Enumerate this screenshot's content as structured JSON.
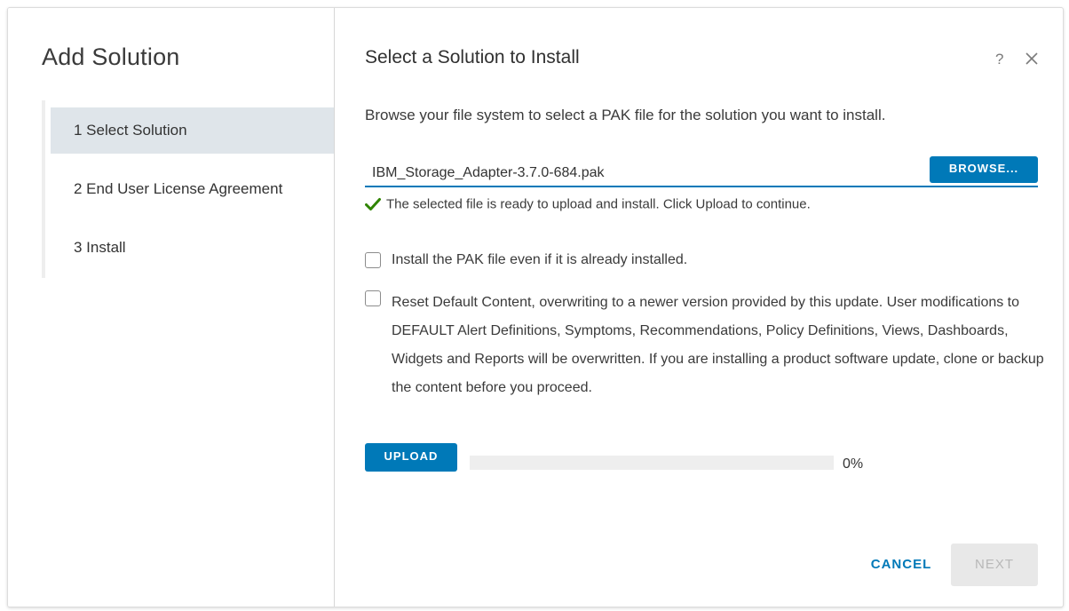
{
  "wizard": {
    "title": "Add Solution",
    "steps": [
      {
        "label": "1 Select Solution",
        "active": true
      },
      {
        "label": "2 End User License Agreement",
        "active": false
      },
      {
        "label": "3 Install",
        "active": false
      }
    ]
  },
  "page": {
    "title": "Select a Solution to Install",
    "help_label": "?",
    "instructions": "Browse your file system to select a PAK file for the solution you want to install."
  },
  "file": {
    "name": "IBM_Storage_Adapter-3.7.0-684.pak",
    "browse_label": "BROWSE...",
    "status": "The selected file is ready to upload and install. Click Upload to continue."
  },
  "options": {
    "reinstall": {
      "label": "Install the PAK file even if it is already installed.",
      "checked": false
    },
    "reset": {
      "label": "Reset Default Content, overwriting to a newer version provided by this update. User modifications to DEFAULT Alert Definitions, Symptoms, Recommendations, Policy Definitions, Views, Dashboards, Widgets and Reports will be overwritten. If you are installing a product software update, clone or backup the content before you proceed.",
      "checked": false
    }
  },
  "upload": {
    "label": "UPLOAD",
    "progress": 0,
    "progress_text": "0%"
  },
  "footer": {
    "cancel_label": "CANCEL",
    "next_label": "NEXT",
    "next_enabled": false
  },
  "colors": {
    "accent": "#0079b8",
    "success": "#2f8400",
    "active_step": "#dfe5ea",
    "disabled_bg": "#e8e8e8",
    "disabled_text": "#b8b8b8"
  },
  "icons": {
    "help": "help-icon",
    "close": "close-icon",
    "check": "check-icon"
  }
}
